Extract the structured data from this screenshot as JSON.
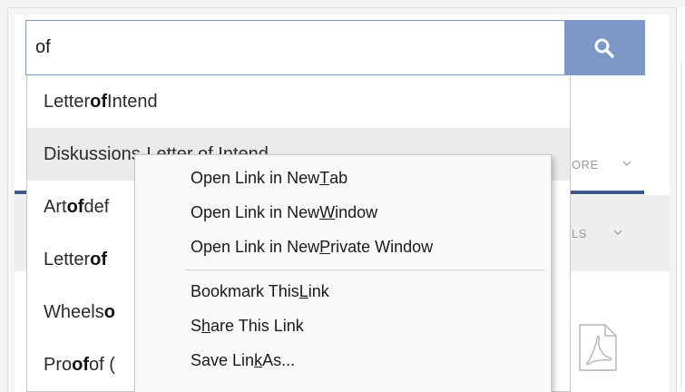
{
  "search": {
    "value": "of",
    "button_icon": "search-icon"
  },
  "suggestions": [
    {
      "before": "Letter ",
      "match": "of",
      "after": " Intend"
    },
    {
      "before": "Diskussions-Letter of Intend",
      "match": "",
      "after": ""
    },
    {
      "before": "Art ",
      "match": "of",
      "after": " def"
    },
    {
      "before": "Letter ",
      "match": "of",
      "after": ""
    },
    {
      "before": "Wheels ",
      "match": "o",
      "after": ""
    },
    {
      "before": "Pro",
      "match": "of",
      "after": " of ("
    }
  ],
  "background": {
    "label_1": "ORE",
    "label_2": "LS"
  },
  "context_menu": {
    "items": [
      {
        "pre": "Open Link in New ",
        "key": "T",
        "post": "ab"
      },
      {
        "pre": "Open Link in New ",
        "key": "W",
        "post": "indow"
      },
      {
        "pre": "Open Link in New ",
        "key": "P",
        "post": "rivate Window"
      },
      {
        "pre": "Bookmark This ",
        "key": "L",
        "post": "ink"
      },
      {
        "pre": "S",
        "key": "h",
        "post": "are This Link"
      },
      {
        "pre": "Save Lin",
        "key": "k",
        "post": " As..."
      }
    ]
  },
  "colors": {
    "search_button": "#7d98c6",
    "search_border": "#7f9ccf",
    "accent_rule": "#3b5a8c",
    "hover_row": "#ebebeb"
  }
}
